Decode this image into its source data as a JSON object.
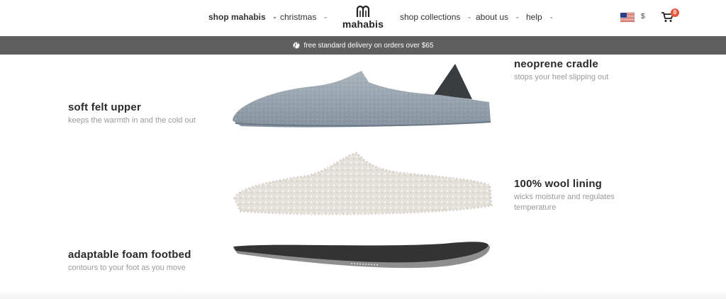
{
  "nav": {
    "shop_mahabis": "shop mahabis",
    "christmas": "christmas",
    "shop_collections": "shop collections",
    "about_us": "about us",
    "help": "help"
  },
  "logo": {
    "text": "mahabis"
  },
  "currency": "$",
  "cart": {
    "count": "0"
  },
  "promo": {
    "text": "free standard delivery on orders over $65"
  },
  "features": {
    "upper": {
      "title": "soft felt upper",
      "desc": "keeps the warmth in and the cold out"
    },
    "cradle": {
      "title": "neoprene cradle",
      "desc": "stops your heel slipping out"
    },
    "lining": {
      "title": "100% wool lining",
      "desc_line1": "wicks moisture and regulates",
      "desc_line2": "temperature"
    },
    "footbed": {
      "title": "adaptable foam footbed",
      "desc": "contours to your foot as you move"
    }
  },
  "colors": {
    "promo_bg": "#5f5f5f",
    "badge": "#e8583d",
    "felt": "#9aa6ae",
    "wool": "#e6e3de",
    "sole": "#3a3a3a"
  }
}
